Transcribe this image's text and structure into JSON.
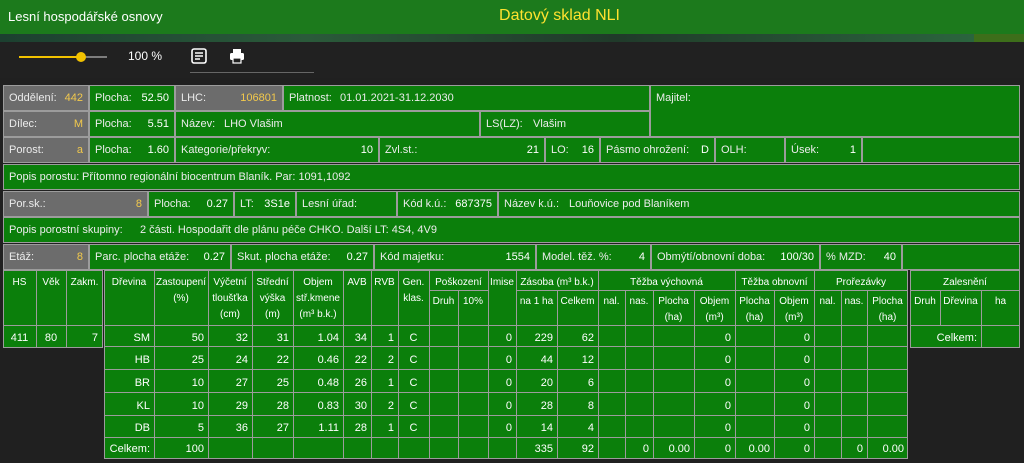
{
  "header": {
    "app_title": "Lesní hospodářské osnovy",
    "center_title": "Datový sklad NLI"
  },
  "toolbar": {
    "zoom_value": 0.7,
    "zoom_label": "100 %",
    "icons": [
      "notes-icon",
      "print-icon"
    ]
  },
  "r1": {
    "oddeleni_l": "Oddělení:",
    "oddeleni_v": "442",
    "plocha_l": "Plocha:",
    "plocha_v": "52.50",
    "lhc_l": "LHC:",
    "lhc_v": "106801",
    "platnost_l": "Platnost:",
    "platnost_v": "01.01.2021-31.12.2030",
    "majitel_l": "Majitel:"
  },
  "r2": {
    "dilec_l": "Dílec:",
    "dilec_v": "M",
    "plocha_l": "Plocha:",
    "plocha_v": "5.51",
    "nazev_l": "Název:",
    "nazev_v": "LHO Vlašim",
    "ls_l": "LS(LZ):",
    "ls_v": "Vlašim"
  },
  "r3": {
    "porost_l": "Porost:",
    "porost_v": "a",
    "plocha_l": "Plocha:",
    "plocha_v": "1.60",
    "kat_l": "Kategorie/překryv:",
    "kat_v": "10",
    "zvl_l": "Zvl.st.:",
    "zvl_v": "21",
    "lo_l": "LO:",
    "lo_v": "16",
    "pasmo_l": "Pásmo ohrožení:",
    "pasmo_v": "D",
    "olh_l": "OLH:",
    "usek_l": "Úsek:",
    "usek_v": "1"
  },
  "r4": {
    "popis_l": "Popis porostu:",
    "popis_v": "Přítomno regionální biocentrum Blaník. Par: 1091,1092"
  },
  "r5": {
    "porsk_l": "Por.sk.:",
    "porsk_v": "8",
    "plocha_l": "Plocha:",
    "plocha_v": "0.27",
    "lt_l": "LT:",
    "lt_v": "3S1e",
    "lesuraad_l": "Lesní úřad:",
    "kodku_l": "Kód k.ú.:",
    "kodku_v": "687375",
    "nazevku_l": "Název k.ú.:",
    "nazevku_v": "Louňovice pod Blaníkem"
  },
  "r6": {
    "popis_l": "Popis porostní skupiny:",
    "popis_v": "2 části. Hospodařit dle plánu péče CHKO. Další LT: 4S4, 4V9"
  },
  "r7": {
    "etaz_l": "Etáž:",
    "etaz_v": "8",
    "parc_l": "Parc. plocha etáže:",
    "parc_v": "0.27",
    "skut_l": "Skut. plocha etáže:",
    "skut_v": "0.27",
    "kodmaj_l": "Kód majetku:",
    "kodmaj_v": "1554",
    "model_l": "Model. těž. %:",
    "model_v": "4",
    "obmyti_l": "Obmýtí/obnovní doba:",
    "obmyti_v": "100/30",
    "mzd_l": "% MZD:",
    "mzd_v": "40"
  },
  "left_table": {
    "headers": [
      "HS",
      "Věk",
      "Zakm."
    ],
    "values": [
      "411",
      "80",
      "7"
    ]
  },
  "main_table": {
    "h_dreviny": "Dřevina",
    "h_zastoupeni": "Zastoupení",
    "h_zastoupeni_u": "(%)",
    "h_tloustka1": "Výčetní",
    "h_tloustka2": "tloušťka",
    "h_tloustka_u": "(cm)",
    "h_vyska1": "Střední",
    "h_vyska2": "výška",
    "h_vyska_u": "(m)",
    "h_objem1": "Objem",
    "h_objem2": "stř.kmene",
    "h_objem_u": "(m³ b.k.)",
    "h_avb": "AVB",
    "h_rvb": "RVB",
    "h_gen1": "Gen.",
    "h_gen2": "klas.",
    "h_poskozeni": "Poškození",
    "h_druh": "Druh",
    "h_10": "10%",
    "h_imise": "Imise",
    "h_zasoba": "Zásoba (m³ b.k.)",
    "h_na1ha": "na 1 ha",
    "h_celkem": "Celkem",
    "h_tezba_v": "Těžba výchovná",
    "h_tezba_o": "Těžba obnovní",
    "h_prorezavky": "Prořezávky",
    "h_nal": "nal.",
    "h_nas": "nas.",
    "h_plocha": "Plocha",
    "h_ha": "(ha)",
    "h_objem": "Objem",
    "h_m3": "(m³)",
    "rows": [
      [
        "SM",
        "50",
        "32",
        "31",
        "1.04",
        "34",
        "1",
        "C",
        "",
        "",
        "0",
        "229",
        "62",
        "",
        "",
        "",
        "0",
        "",
        "0",
        "",
        "",
        ""
      ],
      [
        "HB",
        "25",
        "24",
        "22",
        "0.46",
        "22",
        "2",
        "C",
        "",
        "",
        "0",
        "44",
        "12",
        "",
        "",
        "",
        "0",
        "",
        "0",
        "",
        "",
        ""
      ],
      [
        "BR",
        "10",
        "27",
        "25",
        "0.48",
        "26",
        "1",
        "C",
        "",
        "",
        "0",
        "20",
        "6",
        "",
        "",
        "",
        "0",
        "",
        "0",
        "",
        "",
        ""
      ],
      [
        "KL",
        "10",
        "29",
        "28",
        "0.83",
        "30",
        "2",
        "C",
        "",
        "",
        "0",
        "28",
        "8",
        "",
        "",
        "",
        "0",
        "",
        "0",
        "",
        "",
        ""
      ],
      [
        "DB",
        "5",
        "36",
        "27",
        "1.11",
        "28",
        "1",
        "C",
        "",
        "",
        "0",
        "14",
        "4",
        "",
        "",
        "",
        "0",
        "",
        "0",
        "",
        "",
        ""
      ]
    ],
    "total_label": "Celkem:",
    "total": [
      "100",
      "335",
      "92",
      "0",
      "0.00",
      "0",
      "0.00",
      "0",
      "0",
      "0.00"
    ]
  },
  "zalesneni": {
    "title": "Zalesnění",
    "druh": "Druh",
    "drevina": "Dřevina",
    "ha": "ha",
    "celkem": "Celkem:"
  }
}
